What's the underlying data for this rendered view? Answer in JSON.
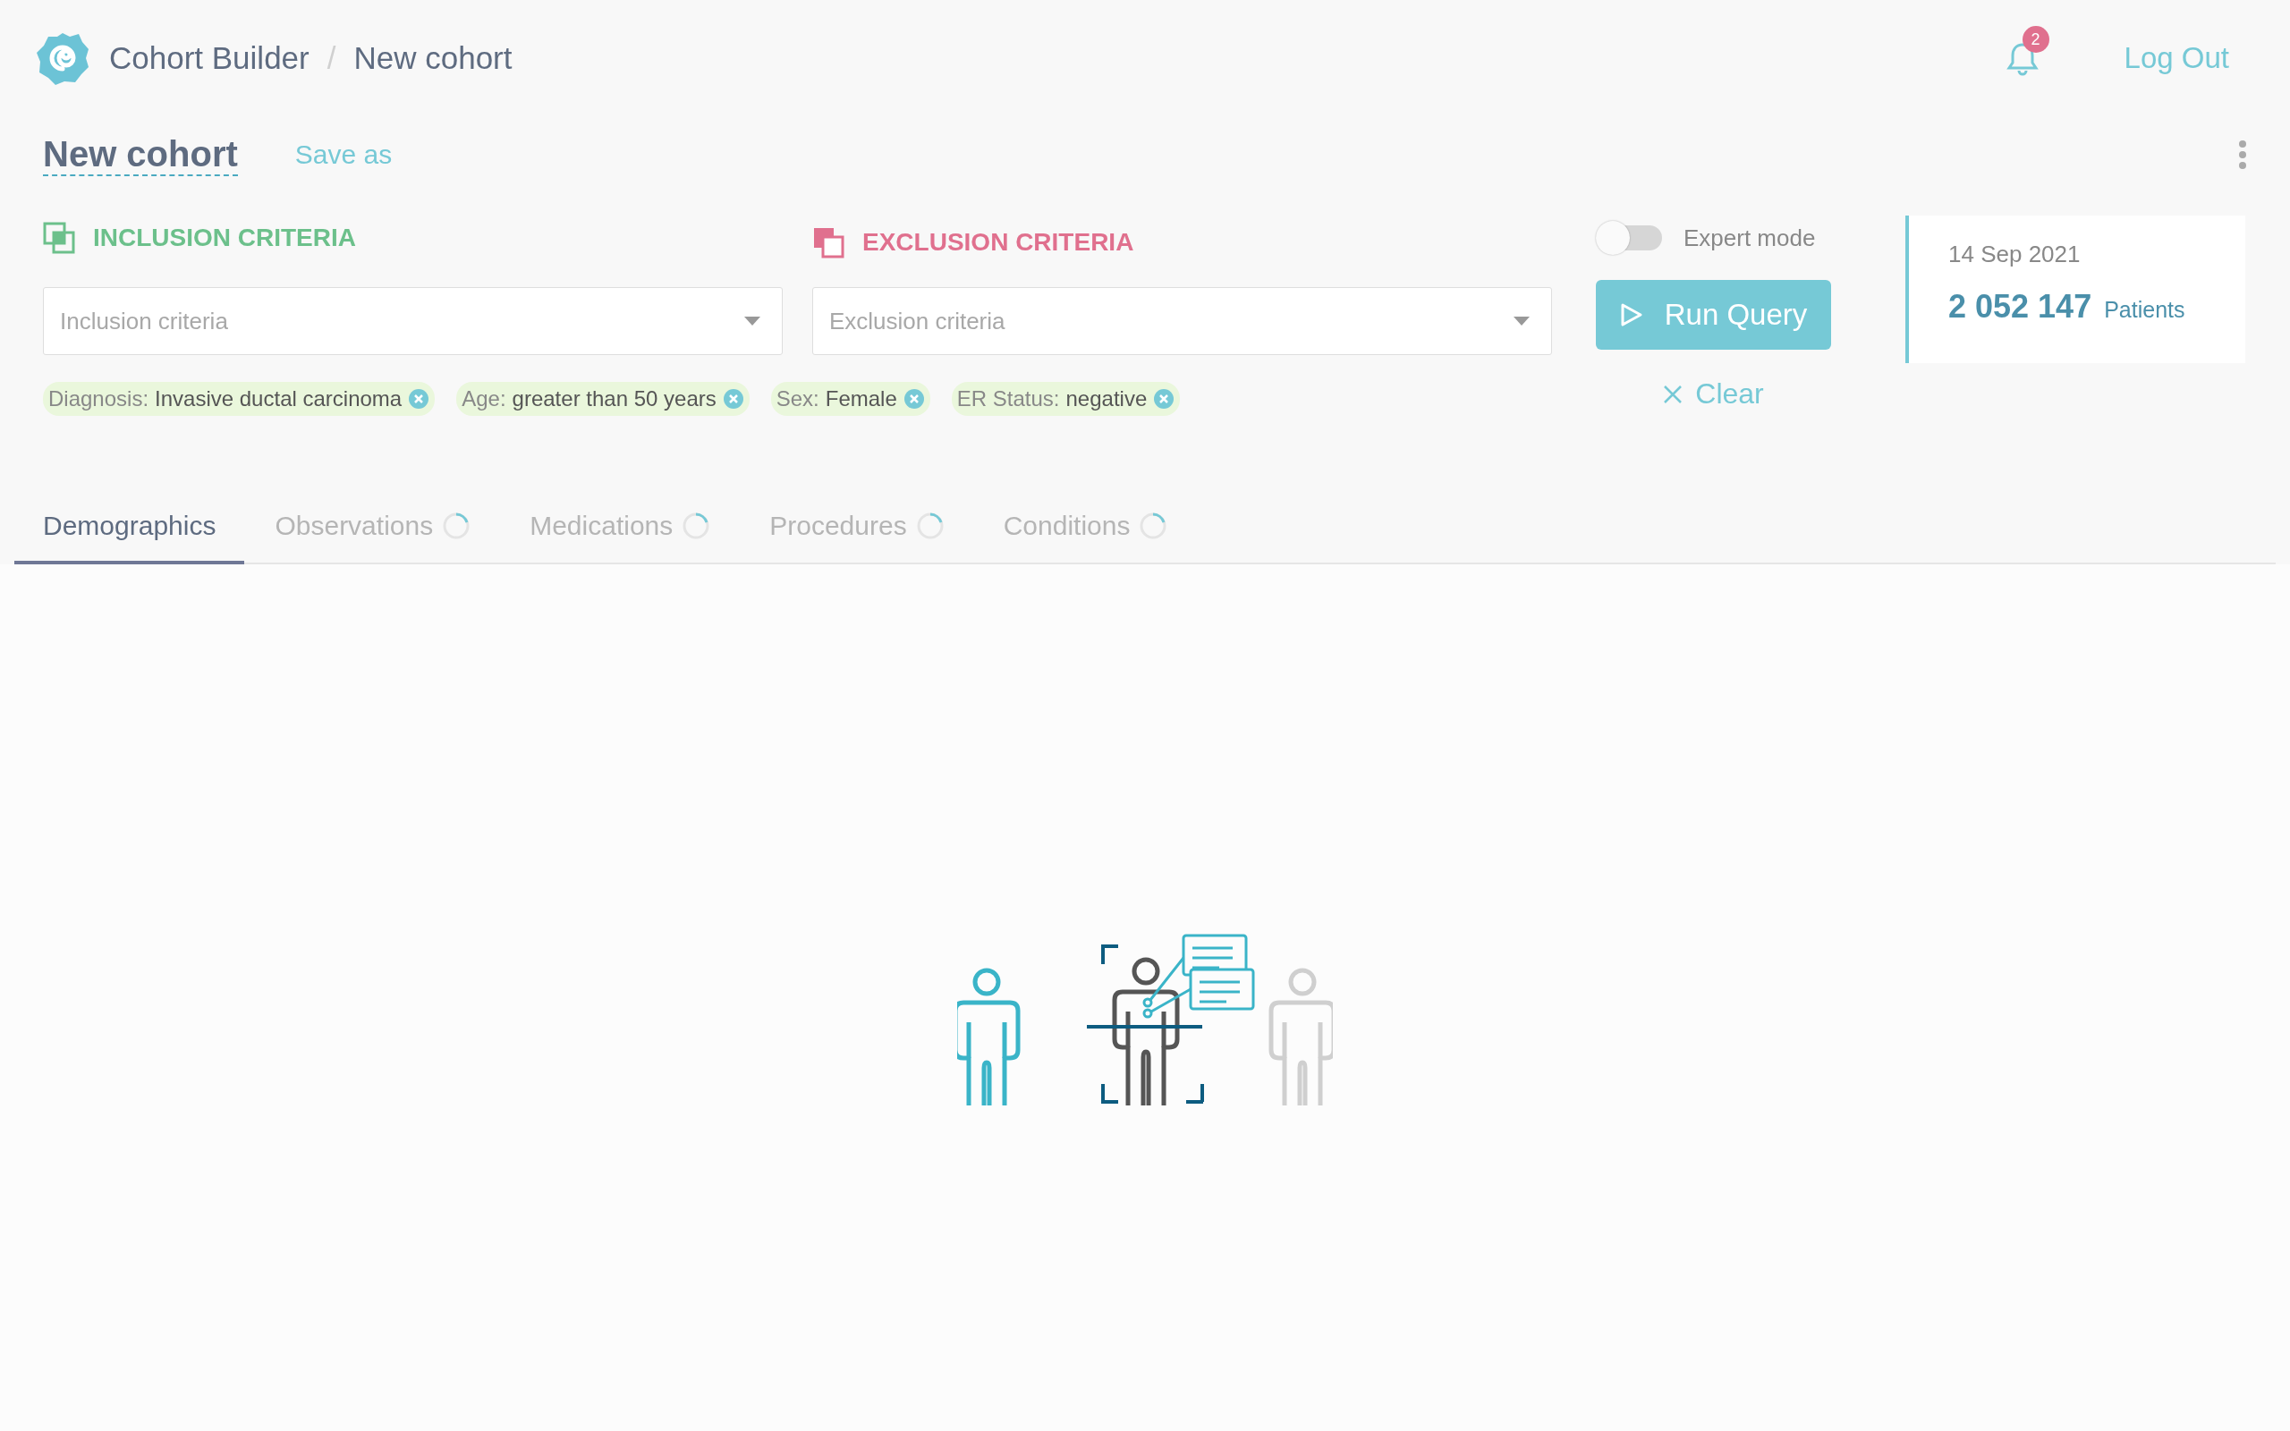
{
  "header": {
    "app_name": "Cohort Builder",
    "separator": "/",
    "crumb": "New cohort",
    "notifications": "2",
    "logout": "Log Out"
  },
  "cohort": {
    "title": "New cohort",
    "save_as": "Save as"
  },
  "inclusion": {
    "heading": "INCLUSION CRITERIA",
    "placeholder": "Inclusion criteria"
  },
  "exclusion": {
    "heading": "EXCLUSION CRITERIA",
    "placeholder": "Exclusion criteria"
  },
  "chips": [
    {
      "label": "Diagnosis:",
      "value": "Invasive ductal carcinoma"
    },
    {
      "label": "Age:",
      "value": "greater than 50 years"
    },
    {
      "label": "Sex:",
      "value": "Female"
    },
    {
      "label": "ER Status:",
      "value": "negative"
    }
  ],
  "expert_mode": {
    "label": "Expert mode",
    "on": false
  },
  "run_query": "Run Query",
  "clear": "Clear",
  "summary": {
    "date": "14 Sep 2021",
    "count": "2 052 147",
    "unit": "Patients"
  },
  "tabs": [
    {
      "label": "Demographics",
      "selected": true,
      "loading": false
    },
    {
      "label": "Observations",
      "selected": false,
      "loading": true
    },
    {
      "label": "Medications",
      "selected": false,
      "loading": true
    },
    {
      "label": "Procedures",
      "selected": false,
      "loading": true
    },
    {
      "label": "Conditions",
      "selected": false,
      "loading": true
    }
  ]
}
